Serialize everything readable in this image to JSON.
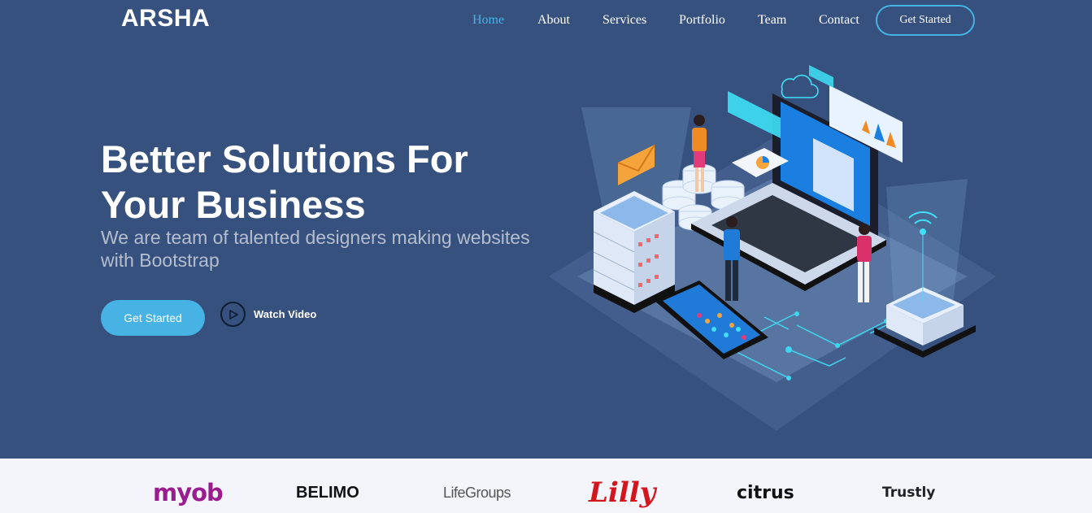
{
  "brand": {
    "logo": "ARSHA"
  },
  "nav": {
    "items": [
      {
        "label": "Home",
        "active": true
      },
      {
        "label": "About"
      },
      {
        "label": "Services"
      },
      {
        "label": "Portfolio"
      },
      {
        "label": "Team"
      },
      {
        "label": "Contact"
      }
    ],
    "cta_label": "Get Started"
  },
  "hero": {
    "title_line1": "Better Solutions For",
    "title_line2": "Your Business",
    "subtitle": "We are team of talented designers making websites with Bootstrap",
    "primary_button": "Get Started",
    "video_button": "Watch Video"
  },
  "clients": {
    "logos": [
      "myob",
      "BELIMO",
      "LifeGroups",
      "Lilly",
      "citrus",
      "Trustly"
    ]
  },
  "colors": {
    "background": "#37517e",
    "accent": "#47b2e4",
    "clients_bg": "#f3f5fa"
  },
  "icons": [
    "play-icon",
    "cloud-icon",
    "envelope-icon",
    "wifi-icon"
  ]
}
